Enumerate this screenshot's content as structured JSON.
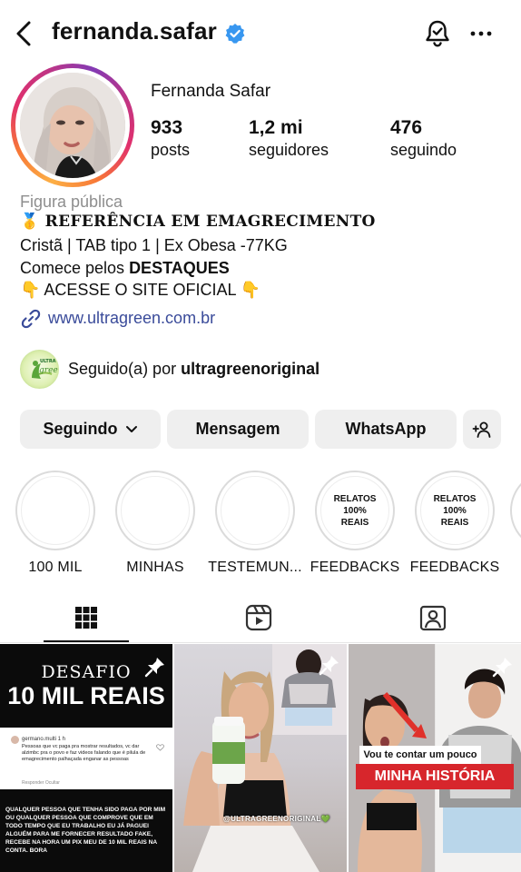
{
  "header": {
    "username": "fernanda.safar",
    "icons": [
      "back-icon",
      "verified-badge-icon",
      "notification-bell-icon",
      "more-icon"
    ]
  },
  "profile": {
    "full_name": "Fernanda Safar",
    "stats": [
      {
        "number": "933",
        "label": "posts"
      },
      {
        "number": "1,2 mi",
        "label": "seguidores"
      },
      {
        "number": "476",
        "label": "seguindo"
      }
    ],
    "category": "Figura pública",
    "bio": {
      "line1": "🥇 𝐑𝐄𝐅𝐄𝐑Ê𝐍𝐂𝐈𝐀 𝐄𝐌 𝐄𝐌𝐀𝐆𝐑𝐄𝐂𝐈𝐌𝐄𝐍𝐓𝐎",
      "line2": "Cristã | TAB tipo 1 | Ex Obesa -77KG",
      "line3_prefix": "Comece pelos ",
      "line3_bold": "DESTAQUES",
      "line4": "👇 ACESSE O SITE OFICIAL 👇"
    },
    "link": "www.ultragreen.com.br",
    "followed_by_prefix": "Seguido(a) por ",
    "followed_by_user": "ultragreenoriginal"
  },
  "actions": {
    "following": "Seguindo",
    "message": "Mensagem",
    "whatsapp": "WhatsApp"
  },
  "highlights": [
    {
      "label": "100 MIL",
      "cover": ""
    },
    {
      "label": "MINHAS",
      "cover": ""
    },
    {
      "label": "TESTEMUN...",
      "cover": ""
    },
    {
      "label": "FEEDBACKS",
      "cover": "RELATOS 100% REAIS"
    },
    {
      "label": "FEEDBACKS",
      "cover": "RELATOS 100% REAIS"
    }
  ],
  "tabs": [
    "grid-icon",
    "reels-icon",
    "tagged-icon"
  ],
  "posts": {
    "post1": {
      "title1": "DESAFIO",
      "title2": "10 MIL REAIS",
      "comment_user": "germano.multi 1 h",
      "comment_text": "Pessoas que vc paga pra mostrar resultados, vc dar alzimbc pra o povo e faz videos falando que é pilula de emagrecimento palhaçada enganar as pessoas",
      "comment_meta": "Responder     Ocultar",
      "caption": "QUALQUER PESSOA QUE TENHA SIDO PAGA POR MIM OU QUALQUER PESSOA QUE COMPROVE QUE EM TODO TEMPO QUE EU TRABALHO EU JÁ PAGUEI ALGUÉM PARA ME FORNECER RESULTADO FAKE, RECEBE NA HORA UM PIX MEU DE 10 MIL REAIS NA CONTA. BORA"
    },
    "post2": {
      "caption": "@ULTRAGREENORIGINAL💚"
    },
    "post3": {
      "tag1": "Vou te contar um pouco da",
      "tag2": "MINHA HISTÓRIA"
    }
  },
  "colors": {
    "link": "#3a4b9a",
    "verified": "#3897f0",
    "muted": "#8e8e8e",
    "button_bg": "#efefef",
    "story_red": "#d7262c"
  }
}
